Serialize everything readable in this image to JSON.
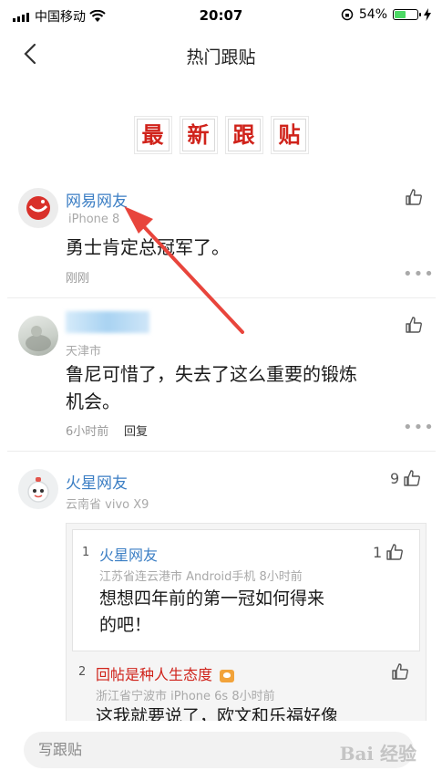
{
  "status_bar": {
    "carrier": "中国移动",
    "time": "20:07",
    "battery": "54%",
    "battery_level": 0.54
  },
  "nav": {
    "title": "热门跟贴",
    "back_icon": "chevron-left-icon"
  },
  "banner": {
    "chars": [
      "最",
      "新",
      "跟",
      "贴"
    ],
    "color": "#d0231b"
  },
  "comments": [
    {
      "user": "网易网友",
      "meta": "iPhone 8",
      "text": "勇士肯定总冠军了。",
      "time": "刚刚"
    },
    {
      "user": "",
      "meta": "天津市",
      "text_line1": "鲁尼可惜了，失去了这么重要的锻炼",
      "text_line2": "机会。",
      "time": "6小时前",
      "reply": "回复"
    },
    {
      "user": "火星网友",
      "meta": "云南省  vivo X9",
      "likes": "9",
      "replies": [
        {
          "index": "1",
          "user": "火星网友",
          "likes": "1",
          "meta": "江苏省连云港市  Android手机  8小时前",
          "text_line1": "想想四年前的第一冠如何得来",
          "text_line2": "的吧！"
        },
        {
          "index": "2",
          "user": "回帖是种人生态度",
          "meta": "浙江省宁波市  iPhone 6s  8小时前",
          "text_line1": "这我就要说了，欧文和乐福好像"
        }
      ]
    }
  ],
  "bottom": {
    "placeholder": "写跟贴"
  },
  "watermark": "Bai 经验",
  "colors": {
    "link_blue": "#3b7ec4",
    "accent_red": "#d0231b",
    "arrow_red": "#e8453c"
  }
}
